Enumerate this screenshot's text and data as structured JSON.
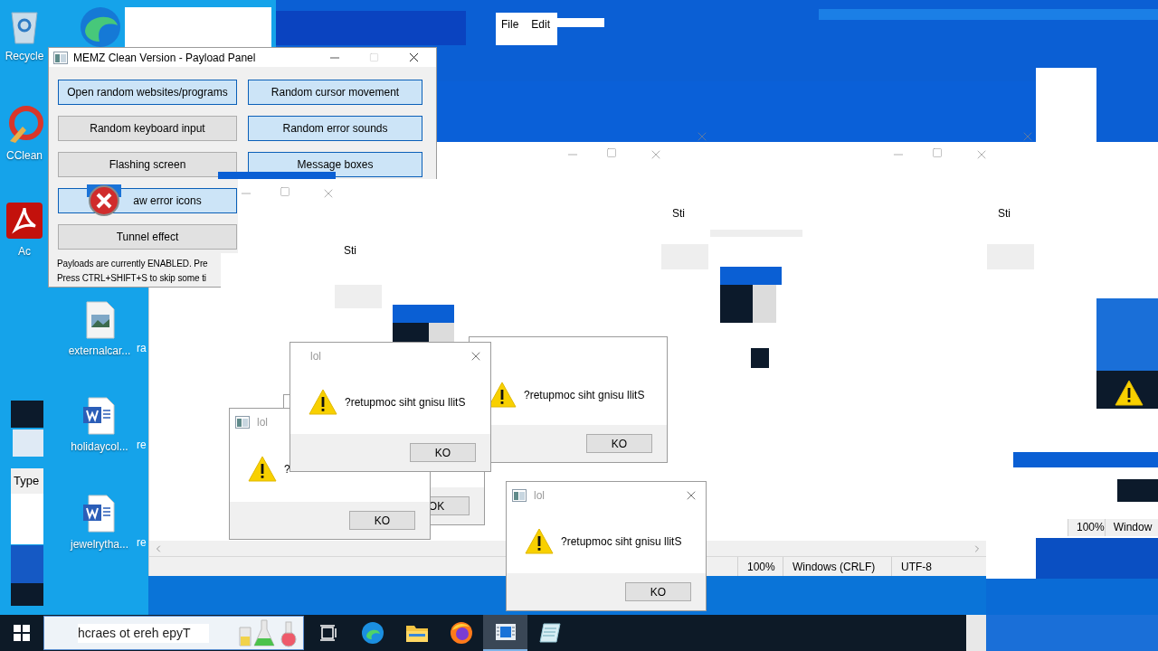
{
  "desktop_icons": [
    {
      "label": "Recycle",
      "kind": "recycle"
    },
    {
      "label": "CClean",
      "kind": "ccleaner"
    },
    {
      "label": "Ac",
      "kind": "pdf"
    },
    {
      "label": "externalcar...",
      "kind": "image"
    },
    {
      "label": "holidaycol...",
      "kind": "word"
    },
    {
      "label": "jewelrytha...",
      "kind": "word"
    }
  ],
  "desktop_fragments": [
    "ra",
    "re",
    "re"
  ],
  "left_strip": {
    "text": "Type"
  },
  "payload_panel": {
    "title": "MEMZ Clean Version - Payload Panel",
    "buttons": [
      {
        "label": "Open random websites/programs",
        "selected": true
      },
      {
        "label": "Random cursor movement",
        "selected": true
      },
      {
        "label": "Random keyboard input",
        "selected": false
      },
      {
        "label": "Random error sounds",
        "selected": true
      },
      {
        "label": "Flashing screen",
        "selected": false
      },
      {
        "label": "Message boxes",
        "selected": true
      },
      {
        "label": "aw error icons",
        "selected": true
      },
      {
        "label": "Tunnel effect",
        "selected": false
      }
    ],
    "status_lines": [
      "Payloads are currently ENABLED. Pre",
      "Press CTRL+SHIFT+S to skip some ti"
    ]
  },
  "notepad": {
    "menu": [
      "File",
      "Edit"
    ],
    "status": [
      "100%",
      "Windows (CRLF)",
      "UTF-8"
    ]
  },
  "ghost_windows": [
    {
      "fragment": "Sti"
    },
    {
      "fragment": "Sti"
    },
    {
      "fragment": "Sti"
    }
  ],
  "message_boxes": [
    {
      "message": "?retupmoc siht gnisu llitS",
      "button": "KO"
    },
    {
      "button": "OK"
    },
    {
      "title": "lol",
      "app_icon": true,
      "message": "?",
      "button": "KO"
    },
    {
      "title": "lol",
      "app_icon": false,
      "close_button": true,
      "message": "?retupmoc siht gnisu llitS",
      "button": "KO"
    },
    {
      "title": "lol",
      "app_icon": true,
      "close_button": true,
      "message": "?retupmoc siht gnisu llitS",
      "button": "KO"
    }
  ],
  "right_window": {
    "status": [
      "100%",
      "Window"
    ]
  },
  "taskbar": {
    "search": {
      "placeholder": "hcraes ot ereh epyT"
    },
    "apps": [
      {
        "kind": "taskview",
        "selected": false
      },
      {
        "kind": "edge",
        "selected": false
      },
      {
        "kind": "folder",
        "selected": false
      },
      {
        "kind": "firefox",
        "selected": false
      },
      {
        "kind": "window",
        "selected": true
      },
      {
        "kind": "notepad",
        "selected": false
      }
    ]
  }
}
